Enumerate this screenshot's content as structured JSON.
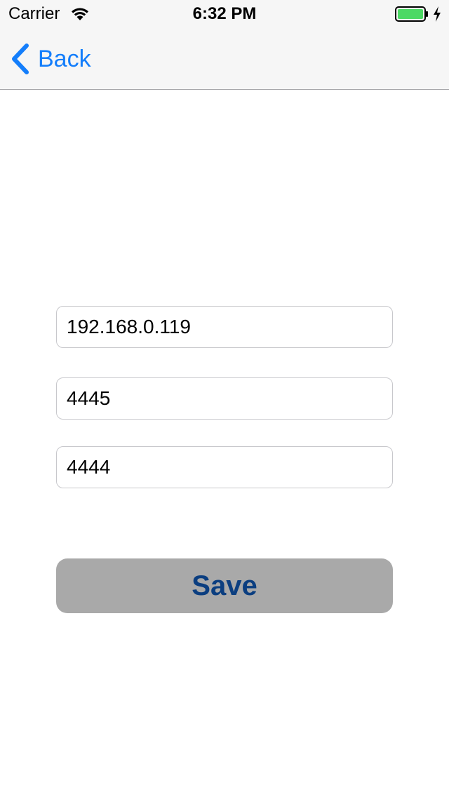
{
  "status_bar": {
    "carrier": "Carrier",
    "time": "6:32 PM",
    "wifi_icon": "wifi-icon",
    "battery_icon": "battery-icon",
    "charging_icon": "charging-bolt-icon",
    "battery_level": 0.9,
    "battery_color": "#4cd964"
  },
  "nav": {
    "back_label": "Back",
    "back_icon": "chevron-left-icon",
    "accent_color": "#147efb"
  },
  "form": {
    "ip_address": "192.168.0.119",
    "port_1": "4445",
    "port_2": "4444",
    "save_label": "Save",
    "save_button_color": "#a9a9a9",
    "save_text_color": "#0b3e80"
  }
}
